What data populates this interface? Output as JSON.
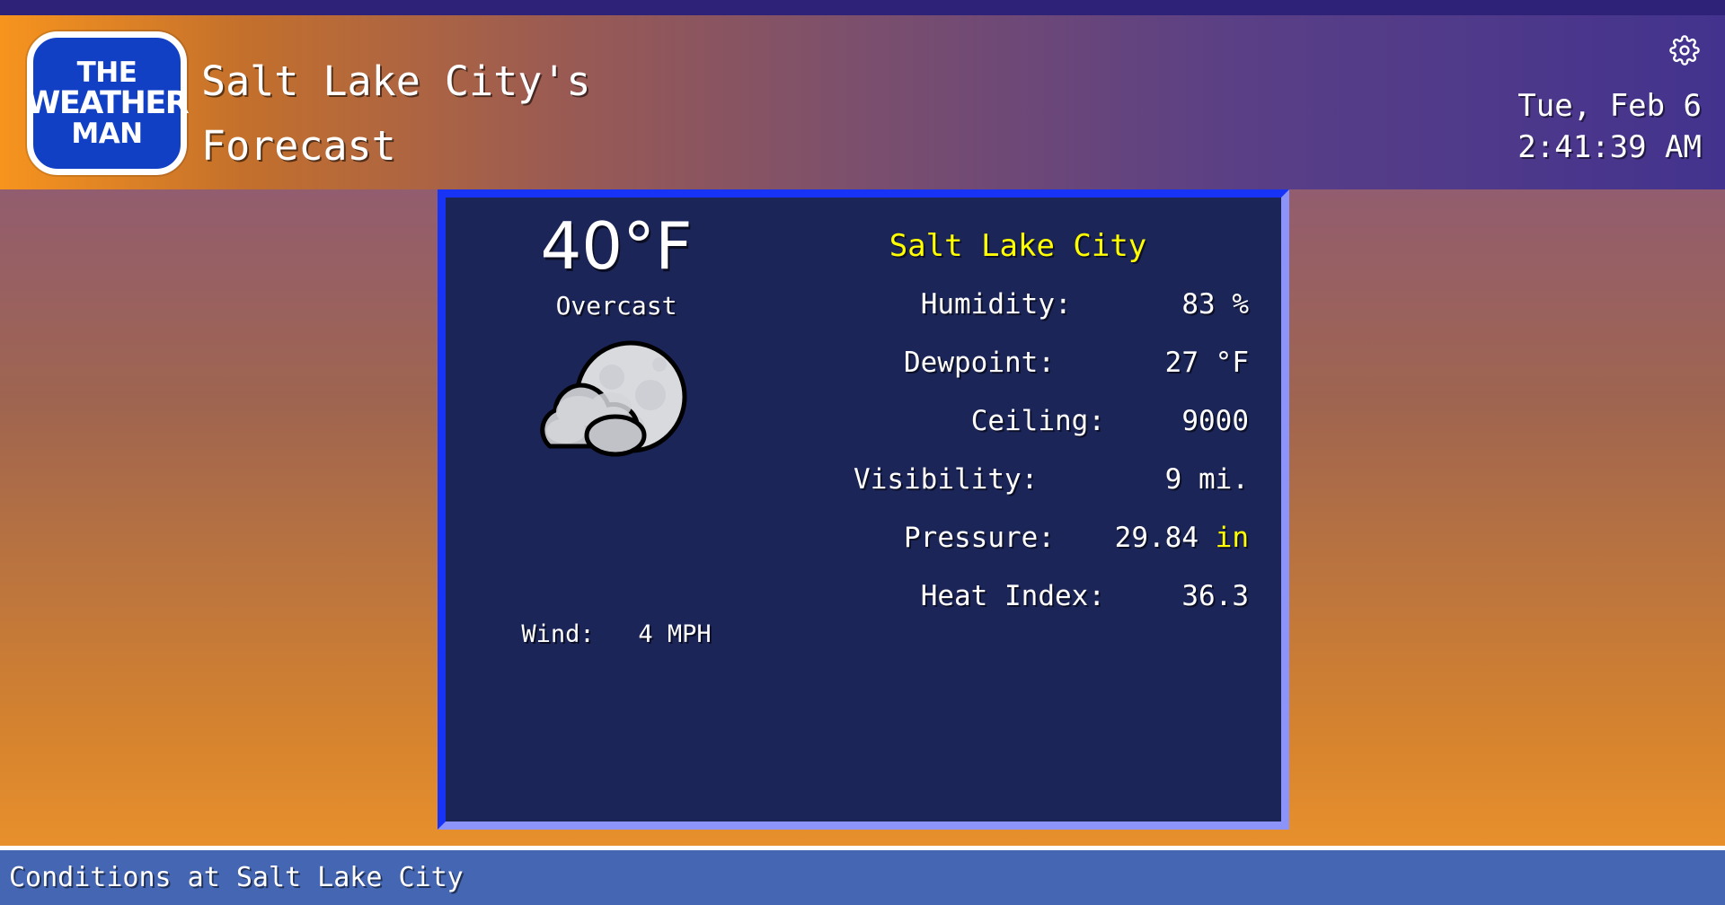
{
  "app": {
    "logo": {
      "line1": "THE",
      "line2": "WEATHER",
      "line3": "MAN"
    },
    "title_line1": "Salt Lake City's",
    "title_line2": "Forecast"
  },
  "header": {
    "settings_icon": "gear-icon",
    "date": "Tue, Feb 6",
    "time": "2:41:39 AM"
  },
  "card": {
    "temperature": "40°F",
    "condition": "Overcast",
    "weather_icon": "cloudy-night-icon",
    "wind": "Wind:   4 MPH",
    "station": "Salt Lake City",
    "metrics": [
      {
        "label": "Humidity:",
        "value": "83",
        "unit": " %",
        "unit_accent": false
      },
      {
        "label": "Dewpoint:",
        "value": "27",
        "unit": " °F",
        "unit_accent": false
      },
      {
        "label": "Ceiling:",
        "value": "9000",
        "unit": "",
        "unit_accent": false
      },
      {
        "label": "Visibility:",
        "value": "9",
        "unit": " mi.",
        "unit_accent": false
      },
      {
        "label": "Pressure:",
        "value": "29.84",
        "unit": " in",
        "unit_accent": true
      },
      {
        "label": "Heat Index:",
        "value": "36.3",
        "unit": "",
        "unit_accent": false
      }
    ]
  },
  "statusbar": {
    "text": "Conditions at Salt Lake City"
  },
  "colors": {
    "accent_yellow": "#ffff00",
    "card_background": "#1c2558",
    "card_border_light": "#1733f5",
    "card_border_shadow": "#8c94fa",
    "statusbar": "#4566b2",
    "logo_blue": "#1240c4",
    "top_strip": "#2e2178"
  }
}
